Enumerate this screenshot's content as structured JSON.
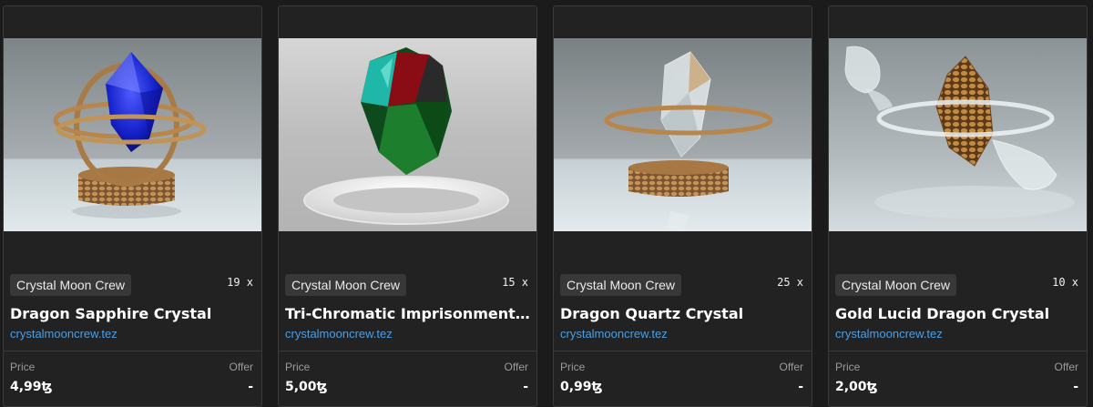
{
  "cards": [
    {
      "collection": "Crystal Moon Crew",
      "edition_count": "19 x",
      "title": "Dragon Sapphire Crystal",
      "creator": "crystalmooncrew.tez",
      "price_label": "Price",
      "price": "4,99ꜩ",
      "offer_label": "Offer",
      "offer": "-",
      "artwork": "blue sapphire gem inside golden rings on honeycomb pedestal"
    },
    {
      "collection": "Crystal Moon Crew",
      "edition_count": "15 x",
      "title": "Tri-Chromatic Imprisonment Cr...",
      "creator": "crystalmooncrew.tez",
      "price_label": "Price",
      "price": "5,00ꜩ",
      "offer_label": "Offer",
      "offer": "-",
      "artwork": "red, cyan and green gem floating above white ring"
    },
    {
      "collection": "Crystal Moon Crew",
      "edition_count": "25 x",
      "title": "Dragon Quartz Crystal",
      "creator": "crystalmooncrew.tez",
      "price_label": "Price",
      "price": "0,99ꜩ",
      "offer_label": "Offer",
      "offer": "-",
      "artwork": "clear quartz crystal with golden ring on honeycomb pedestal"
    },
    {
      "collection": "Crystal Moon Crew",
      "edition_count": "10 x",
      "title": "Gold Lucid Dragon Crystal",
      "creator": "crystalmooncrew.tez",
      "price_label": "Price",
      "price": "2,00ꜩ",
      "offer_label": "Offer",
      "offer": "-",
      "artwork": "gold honeycomb crystal with glass dragon ring"
    }
  ],
  "colors": {
    "background": "#1b1b1b",
    "card": "#222222",
    "link": "#4a9fe6",
    "gold": "#b8864a"
  }
}
